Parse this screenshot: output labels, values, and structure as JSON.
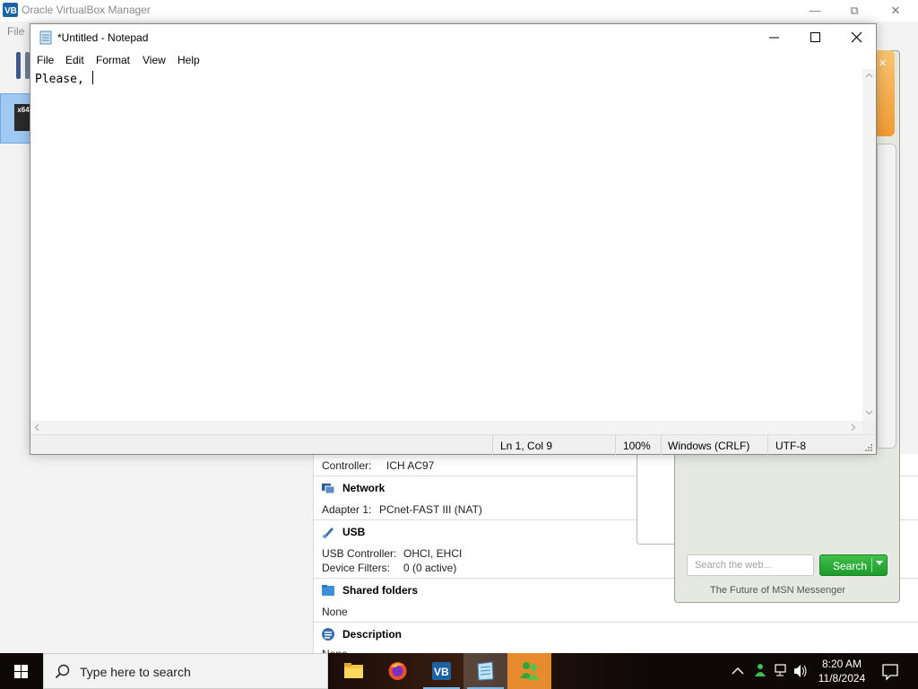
{
  "virtualbox": {
    "title": "Oracle VirtualBox Manager",
    "menu_file": "File",
    "vm_badge": "x64",
    "details": {
      "audio_controller_label": "Controller:",
      "audio_controller_value": "ICH AC97",
      "network_title": "Network",
      "network_adapter_label": "Adapter 1:",
      "network_adapter_value": "PCnet-FAST III (NAT)",
      "usb_title": "USB",
      "usb_controller_label": "USB Controller:",
      "usb_controller_value": "OHCI, EHCI",
      "usb_filters_label": "Device Filters:",
      "usb_filters_value": "0 (0 active)",
      "shared_title": "Shared folders",
      "shared_value": "None",
      "description_title": "Description",
      "description_value": "None"
    }
  },
  "msn": {
    "search_placeholder": "Search the web...",
    "search_button": "Search",
    "footer": "The Future of MSN Messenger"
  },
  "notepad": {
    "title": "*Untitled - Notepad",
    "menu": [
      "File",
      "Edit",
      "Format",
      "View",
      "Help"
    ],
    "content": "Please, ",
    "status": {
      "position": "Ln 1, Col 9",
      "zoom": "100%",
      "line_ending": "Windows (CRLF)",
      "encoding": "UTF-8"
    }
  },
  "taskbar": {
    "search_placeholder": "Type here to search",
    "time": "8:20 AM",
    "date": "11/8/2024",
    "apps": [
      "file-explorer",
      "firefox",
      "virtualbox",
      "notepad",
      "msn-messenger"
    ]
  },
  "colors": {
    "accent": "#0078d7",
    "msn_green": "#22a22f",
    "msn_orange": "#f19a34",
    "taskbar": "#0e0807"
  }
}
